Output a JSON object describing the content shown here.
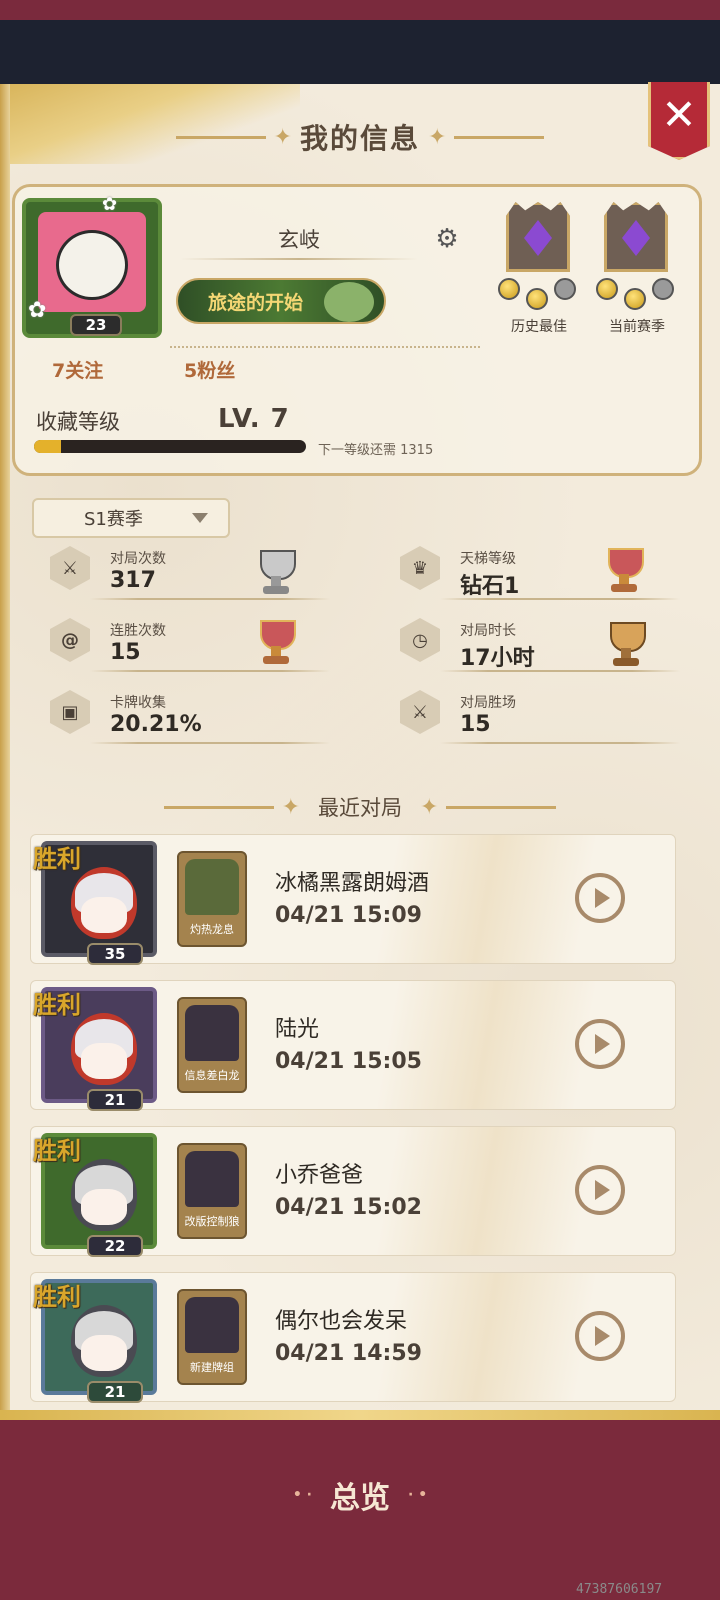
{
  "header": {
    "title": "我的信息"
  },
  "profile": {
    "avatar_level": "23",
    "username": "玄岐",
    "title_banner": "旅途的开始",
    "follows": "7关注",
    "fans": "5粉丝",
    "collection_label": "收藏等级",
    "collection_level": "LV. 7",
    "collection_progress": 0.1,
    "next_level_text": "下一等级还需 1315",
    "ranks": [
      {
        "label": "历史最佳",
        "coins": [
          "gold",
          "gold",
          "grey"
        ]
      },
      {
        "label": "当前赛季",
        "coins": [
          "gold",
          "gold",
          "grey"
        ]
      }
    ]
  },
  "season": {
    "selected": "S1赛季"
  },
  "stats": [
    {
      "label": "对局次数",
      "value": "317",
      "icon": "crossed-swords-icon"
    },
    {
      "label": "天梯等级",
      "value": "钻石1",
      "icon": "crown-icon"
    },
    {
      "label": "连胜次数",
      "value": "15",
      "icon": "spiral-icon"
    },
    {
      "label": "对局时长",
      "value": "17小时",
      "icon": "clock-icon"
    },
    {
      "label": "卡牌收集",
      "value": "20.21%",
      "icon": "card-icon"
    },
    {
      "label": "对局胜场",
      "value": "15",
      "icon": "crossed-swords-icon"
    }
  ],
  "recent": {
    "title": "最近对局",
    "matches": [
      {
        "result": "胜利",
        "level": "35",
        "deck": "灼热龙息",
        "opponent": "冰橘黑露朗姆酒",
        "time": "04/21 15:09"
      },
      {
        "result": "胜利",
        "level": "21",
        "deck": "信息差白龙",
        "opponent": "陆光",
        "time": "04/21 15:05"
      },
      {
        "result": "胜利",
        "level": "22",
        "deck": "改版控制狼",
        "opponent": "小乔爸爸",
        "time": "04/21 15:02"
      },
      {
        "result": "胜利",
        "level": "21",
        "deck": "新建牌组",
        "opponent": "偶尔也会发呆",
        "time": "04/21 14:59"
      }
    ]
  },
  "footer": {
    "overview_label": "总览",
    "id_text": "47387606197"
  },
  "colors": {
    "accent_gold": "#e4b12b",
    "close_red": "#b52a37",
    "bottom_bar": "#7b2a3c"
  }
}
